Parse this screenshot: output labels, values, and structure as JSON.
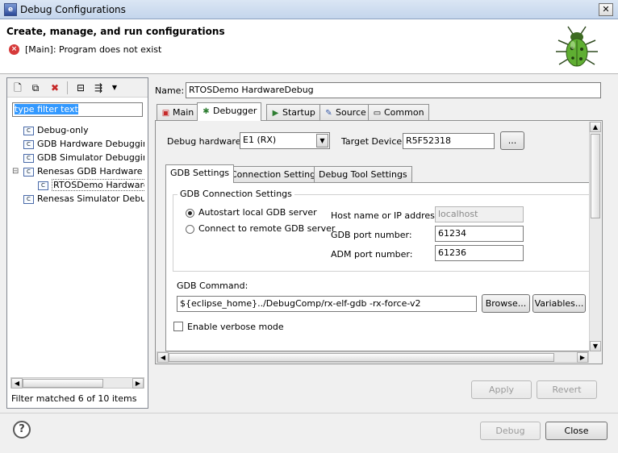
{
  "window": {
    "title": "Debug Configurations",
    "app_icon": "e",
    "close_glyph": "✕"
  },
  "header": {
    "title": "Create, manage, and run configurations",
    "error_message": "[Main]: Program does not exist"
  },
  "left": {
    "filter_text": "type filter text",
    "tree": [
      {
        "label": "Debug-only",
        "indent": 1,
        "expander": ""
      },
      {
        "label": "GDB Hardware Debugging",
        "indent": 1,
        "expander": ""
      },
      {
        "label": "GDB Simulator Debugging",
        "indent": 1,
        "expander": ""
      },
      {
        "label": "Renesas GDB Hardware Debugging",
        "indent": 1,
        "expander": "⊟"
      },
      {
        "label": "RTOSDemo HardwareDebug",
        "indent": 2,
        "expander": "",
        "selected": true
      },
      {
        "label": "Renesas Simulator Debugging",
        "indent": 1,
        "expander": ""
      }
    ],
    "status": "Filter matched 6 of 10 items"
  },
  "name_label": "Name:",
  "name_value": "RTOSDemo HardwareDebug",
  "tabs": [
    "Main",
    "Debugger",
    "Startup",
    "Source",
    "Common"
  ],
  "debugger": {
    "hardware_label": "Debug hardware:",
    "hardware_value": "E1 (RX)",
    "target_label": "Target Device:",
    "target_value": "R5F52318",
    "browse_dots": "...",
    "subtabs": [
      "GDB Settings",
      "Connection Settings",
      "Debug Tool Settings"
    ],
    "group_title": "GDB Connection Settings",
    "autostart_label": "Autostart local GDB server",
    "remote_label": "Connect to remote GDB server",
    "host_label": "Host name or IP address:",
    "host_value": "localhost",
    "gdb_port_label": "GDB port number:",
    "gdb_port_value": "61234",
    "adm_port_label": "ADM port number:",
    "adm_port_value": "61236",
    "command_label": "GDB Command:",
    "command_value": "${eclipse_home}../DebugComp/rx-elf-gdb -rx-force-v2",
    "browse_label": "Browse...",
    "variables_label": "Variables...",
    "verbose_label": "Enable verbose mode"
  },
  "buttons": {
    "apply": "Apply",
    "revert": "Revert",
    "debug": "Debug",
    "close": "Close",
    "help": "?"
  }
}
